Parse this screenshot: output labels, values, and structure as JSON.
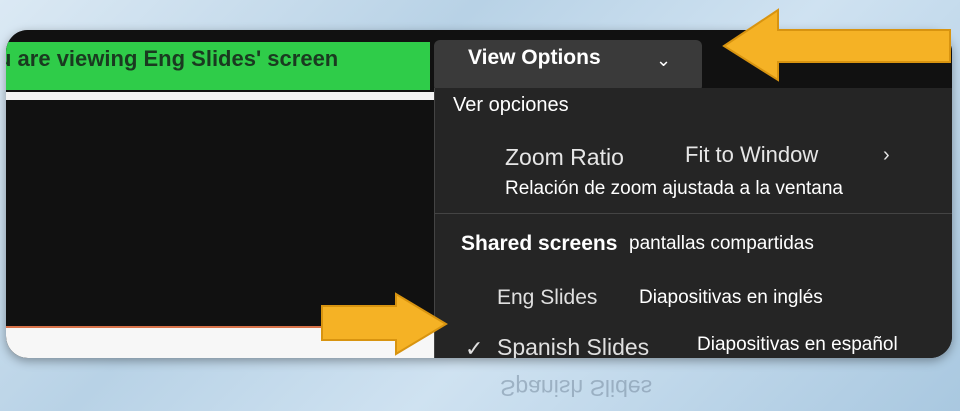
{
  "banner": {
    "text": "u are viewing Eng Slides' screen"
  },
  "view_options_button": {
    "label": "View Options",
    "chevron": "chevron-down-icon"
  },
  "menu": {
    "header_es": "Ver opciones",
    "zoom_ratio": {
      "label": "Zoom Ratio",
      "value": "Fit to Window",
      "chevron": "chevron-right-icon",
      "translation": "Relación de zoom ajustada a la ventana"
    },
    "shared_screens": {
      "label": "Shared screens",
      "translation": "pantallas compartidas"
    },
    "eng_slides": {
      "label": "Eng Slides",
      "translation": "Diapositivas en inglés"
    },
    "spanish_slides": {
      "label": "Spanish Slides",
      "translation": "Diapositivas en español",
      "checked": true
    }
  },
  "reflection_text": "Spanish Slides",
  "colors": {
    "arrow": "#f5b225",
    "banner": "#2fcc49",
    "menu_bg": "#252525"
  }
}
